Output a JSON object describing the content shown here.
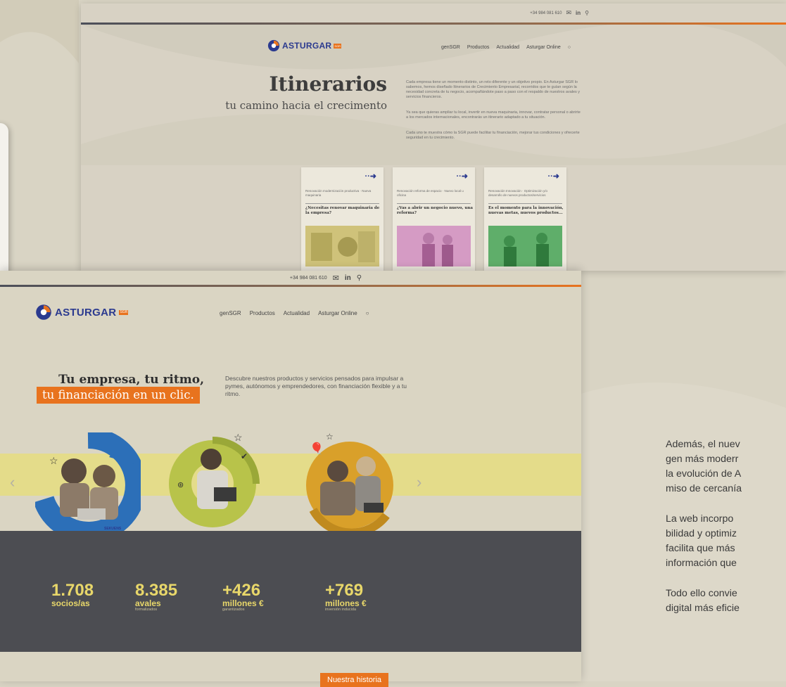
{
  "colors": {
    "brand_blue": "#2b3a8f",
    "brand_orange": "#e8731e",
    "stat_yellow": "#e8d76a",
    "stats_bg": "#4c4d52"
  },
  "back_site": {
    "phone": "+34 984 081 610",
    "logo": {
      "name": "ASTURGAR",
      "badge": "SGR"
    },
    "nav": [
      "genSGR",
      "Productos",
      "Actualidad",
      "Asturgar Online"
    ],
    "hero_title": "Itinerarios",
    "hero_subtitle": "tu camino hacia el crecimento",
    "paragraphs": [
      "Cada empresa tiene un momento distinto, un reto diferente y un objetivo propio. En Asturgar SGR lo sabemos, hemos diseñado Itinerarios de Crecimiento Empresarial, recorridos que te guían según la necesidad concreta de tu negocio, acompañándote paso a paso con el respaldo de nuestros avales y servicios financieros.",
      "Ya sea que quieras ampliar tu local, invertir en nueva maquinaria, innovar, contratar personal o abrirte a los mercados internacionales, encontrarás un itinerario adaptado a tu situación.",
      "Cada uno te muestra cómo la SGR puede facilitar tu financiación, mejorar tus condiciones y ofrecerte seguridad en tu crecimiento."
    ],
    "cards": [
      {
        "meta": "Renovación modernización productiva · Nueva maquinaria",
        "title": "¿Necesitas renovar maquinaria de la empresa?"
      },
      {
        "meta": "Renovación reforma de espacio · Nuevo local u oficina",
        "title": "¿Vas a abrir un negocio nuevo, una reforma?"
      },
      {
        "meta": "Renovación Innovación · Optimización y/o desarrollo de nuevos productos/servicios",
        "title": "Es el momento para la innovación, nuevas metas, nuevos productos..."
      }
    ]
  },
  "front_site": {
    "phone": "+34 984 081 610",
    "logo": {
      "name": "ASTURGAR",
      "badge": "SGR"
    },
    "nav": [
      "genSGR",
      "Productos",
      "Actualidad",
      "Asturgar Online"
    ],
    "headline_line1": "Tu empresa, tu ritmo,",
    "headline_line2": "tu financiación en un clic.",
    "description": "Descubre nuestros productos y servicios pensados para impulsar a pymes, autónomos y emprendedores, con financiación flexible y a tu ritmo.",
    "partner_logo": "SEKUENS",
    "stats": [
      {
        "number": "1.708",
        "label": "socios/as",
        "sub": ""
      },
      {
        "number": "8.385",
        "label": "avales",
        "sub": "formalizados"
      },
      {
        "number": "+426",
        "label": "millones €",
        "sub": "garantizados"
      },
      {
        "number": "+769",
        "label": "millones €",
        "sub": "inversión inducida"
      }
    ],
    "history_button": "Nuestra historia"
  },
  "article": {
    "lines": [
      "Además, el nuev",
      "gen más moderr",
      "la evolución de A",
      "miso de cercanía",
      "",
      "La web incorpo",
      "bilidad y optimiz",
      "facilita que más",
      "información que",
      "",
      "Todo ello convie",
      "digital más eficie"
    ]
  }
}
